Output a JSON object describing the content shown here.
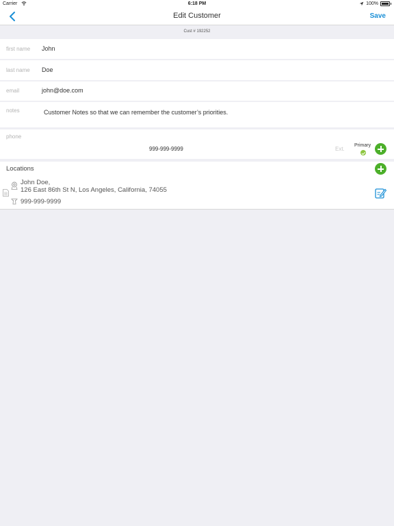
{
  "status": {
    "carrier": "Carrier",
    "time": "6:18 PM",
    "battery": "100%"
  },
  "nav": {
    "title": "Edit Customer",
    "save_label": "Save"
  },
  "cust_number": "Cust # 192252",
  "form": {
    "first_name": {
      "label": "first name",
      "value": "John"
    },
    "last_name": {
      "label": "last name",
      "value": "Doe"
    },
    "email": {
      "label": "email",
      "value": "john@doe.com"
    },
    "notes": {
      "label": "notes",
      "value": "Customer Notes so that we can remember the customer’s priorities."
    },
    "phone": {
      "label": "phone",
      "value": "999-999-9999",
      "ext_placeholder": "Ext.",
      "primary_label": "Primary"
    }
  },
  "locations": {
    "header": "Locations",
    "items": [
      {
        "name": "John Doe,",
        "address": "126 East 86th St N, Los Angeles, California, 74055",
        "phone": "999-999-9999"
      }
    ]
  },
  "colors": {
    "accent_blue": "#1a8fd6",
    "add_green": "#4caf2a",
    "primary_check": "#8dc63f"
  }
}
